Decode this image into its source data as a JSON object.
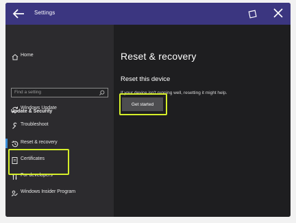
{
  "window": {
    "title": "Settings"
  },
  "sidebar": {
    "home_label": "Home",
    "search_placeholder": "Find a setting",
    "section_title": "Update & Security",
    "items": [
      {
        "label": "Windows Update",
        "icon": "sync-icon"
      },
      {
        "label": "Troubleshoot",
        "icon": "wrench-icon"
      },
      {
        "label": "Reset & recovery",
        "icon": "history-icon",
        "selected": true
      },
      {
        "label": "Certificates",
        "icon": "certificate-icon"
      },
      {
        "label": "For developers",
        "icon": "developer-tools-icon"
      },
      {
        "label": "Windows Insider Program",
        "icon": "insider-icon"
      }
    ]
  },
  "content": {
    "page_title": "Reset & recovery",
    "section_title": "Reset this device",
    "description": "If your device isn't running well, resetting it might help.",
    "button_label": "Get started"
  },
  "colors": {
    "titlebar": "#3b3680",
    "highlight": "#d6ef2a",
    "accent": "#3c8ed8"
  }
}
